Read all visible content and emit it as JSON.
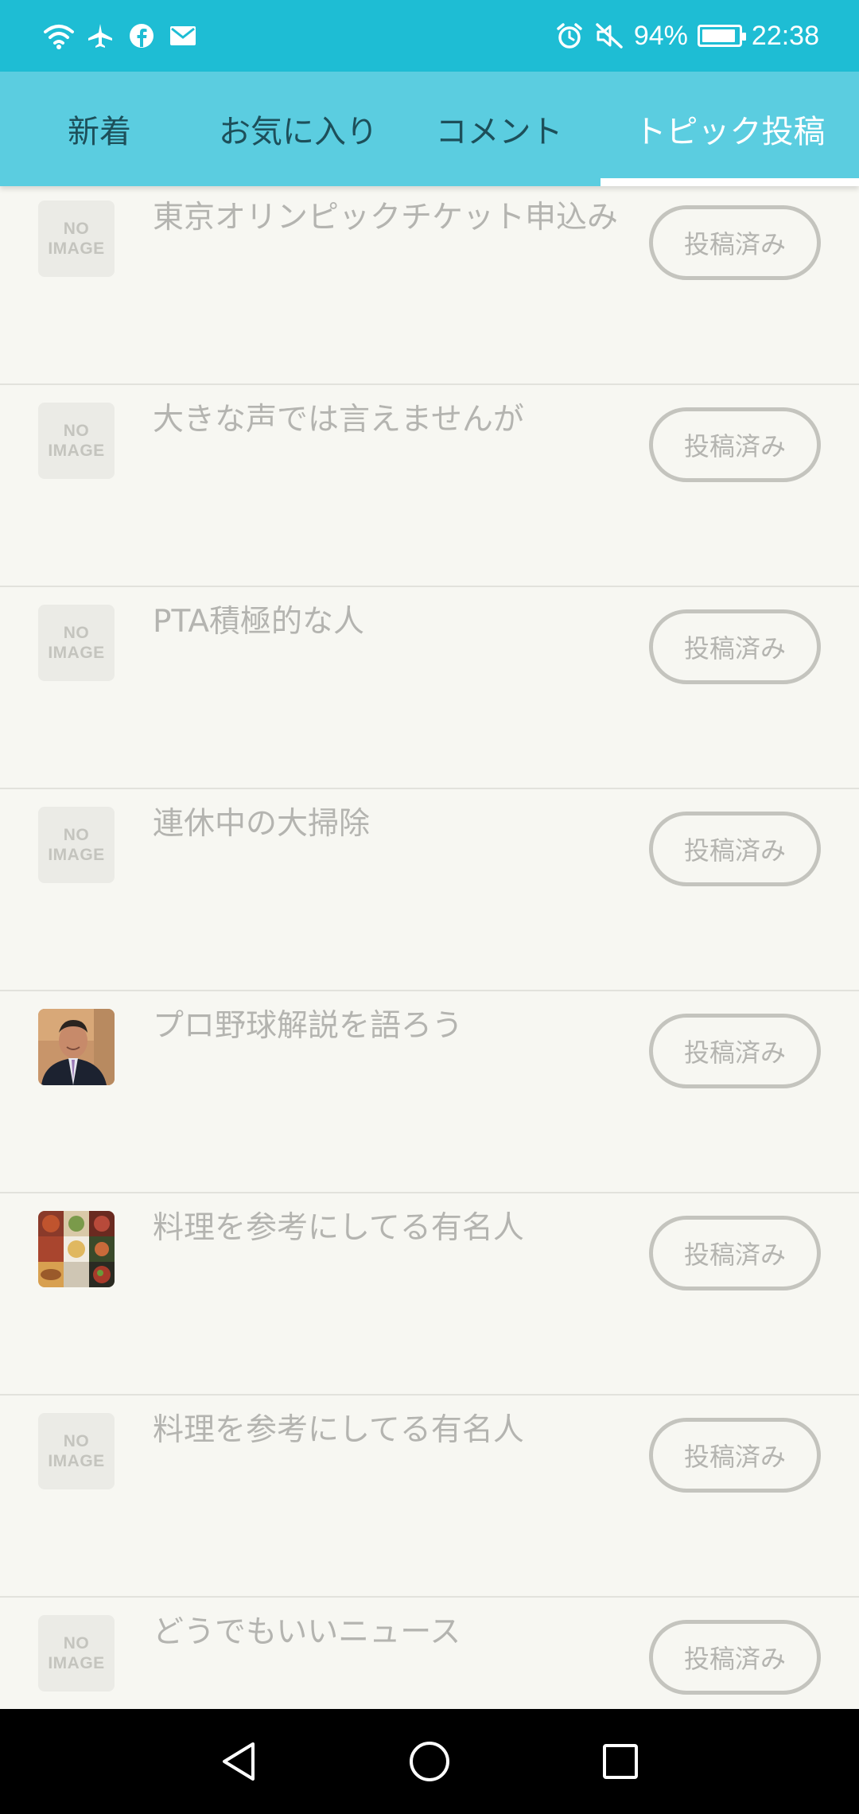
{
  "status_bar": {
    "battery_percent": "94%",
    "battery_level": 0.94,
    "time": "22:38",
    "left_icons": [
      "wifi-icon",
      "airplane-icon",
      "facebook-icon",
      "mail-icon"
    ],
    "right_icons": [
      "alarm-icon",
      "mute-icon"
    ]
  },
  "tabs": [
    {
      "label": "新着",
      "active": false
    },
    {
      "label": "お気に入り",
      "active": false
    },
    {
      "label": "コメント",
      "active": false
    },
    {
      "label": "トピック投稿",
      "active": true
    }
  ],
  "no_image": {
    "line1": "NO",
    "line2": "IMAGE"
  },
  "items": [
    {
      "title": "東京オリンピックチケット申込み",
      "button": "投稿済み",
      "image": "none"
    },
    {
      "title": "大きな声では言えませんが",
      "button": "投稿済み",
      "image": "none"
    },
    {
      "title": "PTA積極的な人",
      "button": "投稿済み",
      "image": "none"
    },
    {
      "title": "連休中の大掃除",
      "button": "投稿済み",
      "image": "none"
    },
    {
      "title": "プロ野球解説を語ろう",
      "button": "投稿済み",
      "image": "person-photo"
    },
    {
      "title": "料理を参考にしてる有名人",
      "button": "投稿済み",
      "image": "food-photo"
    },
    {
      "title": "料理を参考にしてる有名人",
      "button": "投稿済み",
      "image": "none"
    },
    {
      "title": "どうでもいいニュース",
      "button": "投稿済み",
      "image": "none"
    }
  ],
  "colors": {
    "status_bar": "#1ebdd4",
    "tab_bar": "#5bcde0",
    "background": "#f7f7f2",
    "muted_text": "#b4b4b0"
  },
  "nav": [
    "back-icon",
    "home-icon",
    "recents-icon"
  ]
}
